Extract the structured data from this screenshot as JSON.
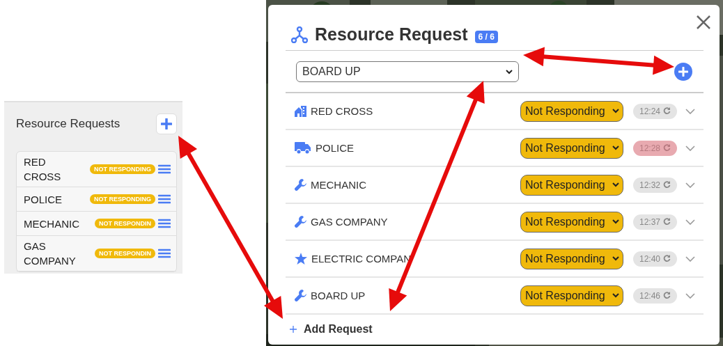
{
  "left_panel": {
    "title": "Resource Requests",
    "items": [
      {
        "name": "RED CROSS",
        "status": "NOT RESPONDING"
      },
      {
        "name": "POLICE",
        "status": "NOT RESPONDING"
      },
      {
        "name": "MECHANIC",
        "status": "NOT RESPONDIN"
      },
      {
        "name": "GAS COMPANY",
        "status": "NOT RESPONDIN"
      }
    ]
  },
  "dialog": {
    "title": "Resource Request",
    "count": "6 / 6",
    "resource_select": {
      "value": "BOARD UP"
    },
    "rows": [
      {
        "kind": "building",
        "name": "RED CROSS",
        "status": "Not Responding",
        "time": "12:24",
        "overdue": false
      },
      {
        "kind": "truck",
        "name": "POLICE",
        "status": "Not Responding",
        "time": "12:28",
        "overdue": true
      },
      {
        "kind": "wrench",
        "name": "MECHANIC",
        "status": "Not Responding",
        "time": "12:32",
        "overdue": false
      },
      {
        "kind": "wrench",
        "name": "GAS COMPANY",
        "status": "Not Responding",
        "time": "12:37",
        "overdue": false
      },
      {
        "kind": "star",
        "name": "ELECTRIC COMPAN",
        "status": "Not Responding",
        "time": "12:40",
        "overdue": false
      },
      {
        "kind": "wrench",
        "name": "BOARD UP",
        "status": "Not Responding",
        "time": "12:46",
        "overdue": false
      }
    ],
    "add_label": "Add Request"
  }
}
